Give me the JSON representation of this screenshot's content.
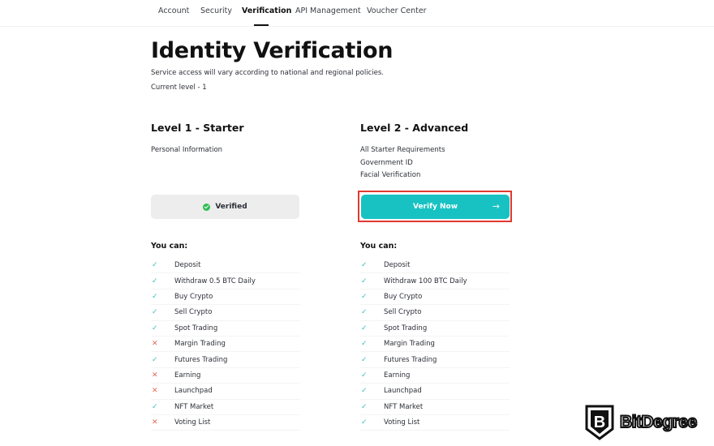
{
  "nav": {
    "tabs": [
      {
        "label": "Account",
        "active": false
      },
      {
        "label": "Security",
        "active": false
      },
      {
        "label": "Verification",
        "active": true
      },
      {
        "label": "API Management",
        "active": false
      },
      {
        "label": "Voucher Center",
        "active": false
      }
    ]
  },
  "header": {
    "title": "Identity Verification",
    "subtitle": "Service access will vary according to national and regional policies.",
    "current_level": "Current level - 1"
  },
  "levels": [
    {
      "title": "Level 1 - Starter",
      "requirements": [
        "Personal Information"
      ],
      "button": {
        "label": "Verified",
        "icon": "check-circle-icon",
        "state": "verified"
      },
      "you_can_label": "You can:",
      "permissions": [
        {
          "label": "Deposit",
          "allowed": true
        },
        {
          "label": "Withdraw 0.5 BTC Daily",
          "allowed": true
        },
        {
          "label": "Buy Crypto",
          "allowed": true
        },
        {
          "label": "Sell Crypto",
          "allowed": true
        },
        {
          "label": "Spot Trading",
          "allowed": true
        },
        {
          "label": "Margin Trading",
          "allowed": false
        },
        {
          "label": "Futures Trading",
          "allowed": true
        },
        {
          "label": "Earning",
          "allowed": false
        },
        {
          "label": "Launchpad",
          "allowed": false
        },
        {
          "label": "NFT Market",
          "allowed": true
        },
        {
          "label": "Voting List",
          "allowed": false
        }
      ]
    },
    {
      "title": "Level 2 - Advanced",
      "requirements": [
        "All Starter Requirements",
        "Government ID",
        "Facial Verification"
      ],
      "button": {
        "label": "Verify Now",
        "icon": "arrow-right-icon",
        "arrow": "→",
        "state": "action"
      },
      "you_can_label": "You can:",
      "permissions": [
        {
          "label": "Deposit",
          "allowed": true
        },
        {
          "label": "Withdraw 100 BTC Daily",
          "allowed": true
        },
        {
          "label": "Buy Crypto",
          "allowed": true
        },
        {
          "label": "Sell Crypto",
          "allowed": true
        },
        {
          "label": "Spot Trading",
          "allowed": true
        },
        {
          "label": "Margin Trading",
          "allowed": true
        },
        {
          "label": "Futures Trading",
          "allowed": true
        },
        {
          "label": "Earning",
          "allowed": true
        },
        {
          "label": "Launchpad",
          "allowed": true
        },
        {
          "label": "NFT Market",
          "allowed": true
        },
        {
          "label": "Voting List",
          "allowed": true
        }
      ]
    }
  ],
  "icons": {
    "yes": "✓",
    "no": "✕"
  },
  "colors": {
    "accent": "#18c2c2",
    "verified_green": "#2ebd55",
    "deny_red": "#e8655a",
    "highlight_red": "#e03a2f"
  },
  "watermark": {
    "text": "BitDegree"
  }
}
